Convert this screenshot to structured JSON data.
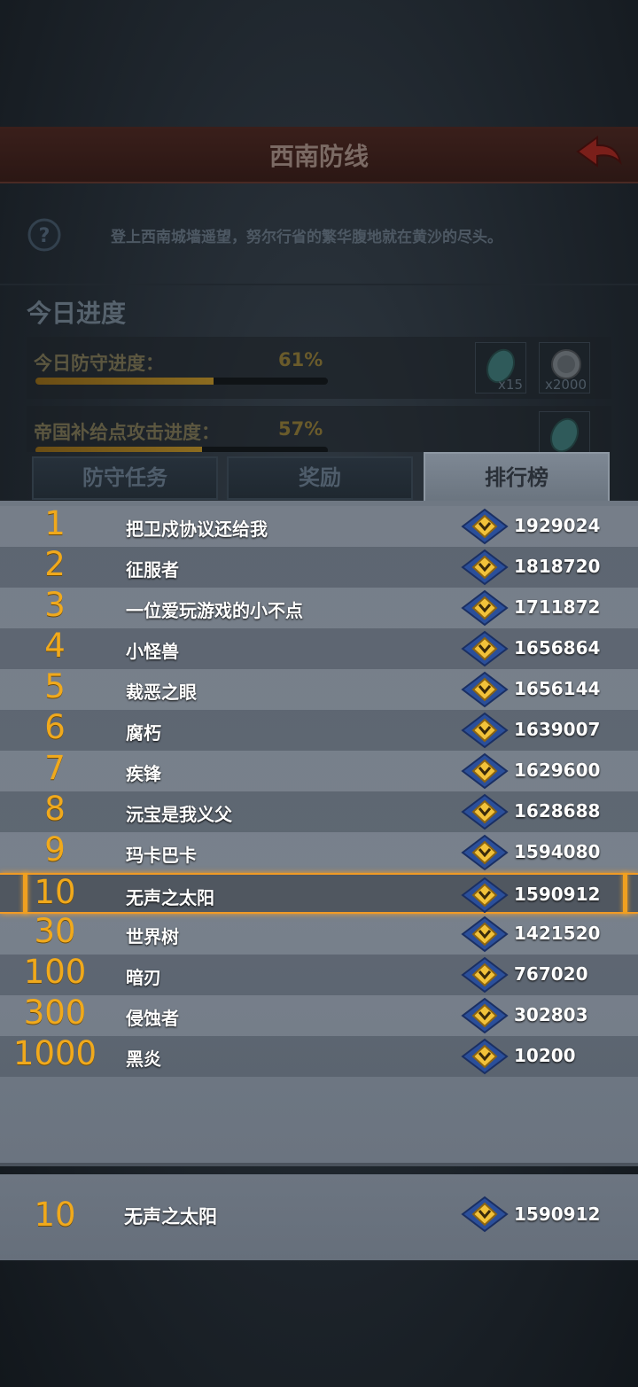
{
  "header": {
    "title": "西南防线"
  },
  "intro": {
    "text": "登上西南城墙遥望，努尔行省的繁华腹地就在黄沙的尽头。"
  },
  "progress": {
    "section_title": "今日进度",
    "items": [
      {
        "label": "今日防守进度：",
        "percent_text": "61%",
        "value": 0.61,
        "rewards": [
          {
            "icon": "gem-icon",
            "count": "x15"
          },
          {
            "icon": "silver-coin-icon",
            "count": "x2000"
          }
        ]
      },
      {
        "label": "帝国补给点攻击进度：",
        "percent_text": "57%",
        "value": 0.57,
        "rewards": [
          {
            "icon": "gem-icon",
            "count": ""
          }
        ]
      }
    ]
  },
  "tabs": [
    {
      "label": "防守任务",
      "active": false
    },
    {
      "label": "奖励",
      "active": false
    },
    {
      "label": "排行榜",
      "active": true
    }
  ],
  "leaderboard": {
    "rows": [
      {
        "rank": "1",
        "name": "把卫戍协议还给我",
        "score": "1929024"
      },
      {
        "rank": "2",
        "name": "征服者",
        "score": "1818720"
      },
      {
        "rank": "3",
        "name": "一位爱玩游戏的小不点",
        "score": "1711872"
      },
      {
        "rank": "4",
        "name": "小怪兽",
        "score": "1656864"
      },
      {
        "rank": "5",
        "name": "裁恶之眼",
        "score": "1656144"
      },
      {
        "rank": "6",
        "name": "腐朽",
        "score": "1639007"
      },
      {
        "rank": "7",
        "name": "疾锋",
        "score": "1629600"
      },
      {
        "rank": "8",
        "name": "沅宝是我义父",
        "score": "1628688"
      },
      {
        "rank": "9",
        "name": "玛卡巴卡",
        "score": "1594080"
      },
      {
        "rank": "10",
        "name": "无声之太阳",
        "score": "1590912"
      },
      {
        "rank": "30",
        "name": "世界树",
        "score": "1421520"
      },
      {
        "rank": "100",
        "name": "暗刃",
        "score": "767020"
      },
      {
        "rank": "300",
        "name": "侵蚀者",
        "score": "302803"
      },
      {
        "rank": "1000",
        "name": "黑炎",
        "score": "10200"
      }
    ],
    "highlight_rank": "10"
  },
  "my_entry": {
    "rank": "10",
    "name": "无声之太阳",
    "score": "1590912"
  },
  "colors": {
    "rank_gold": "#f0a91c",
    "highlight": "#f09a26"
  }
}
